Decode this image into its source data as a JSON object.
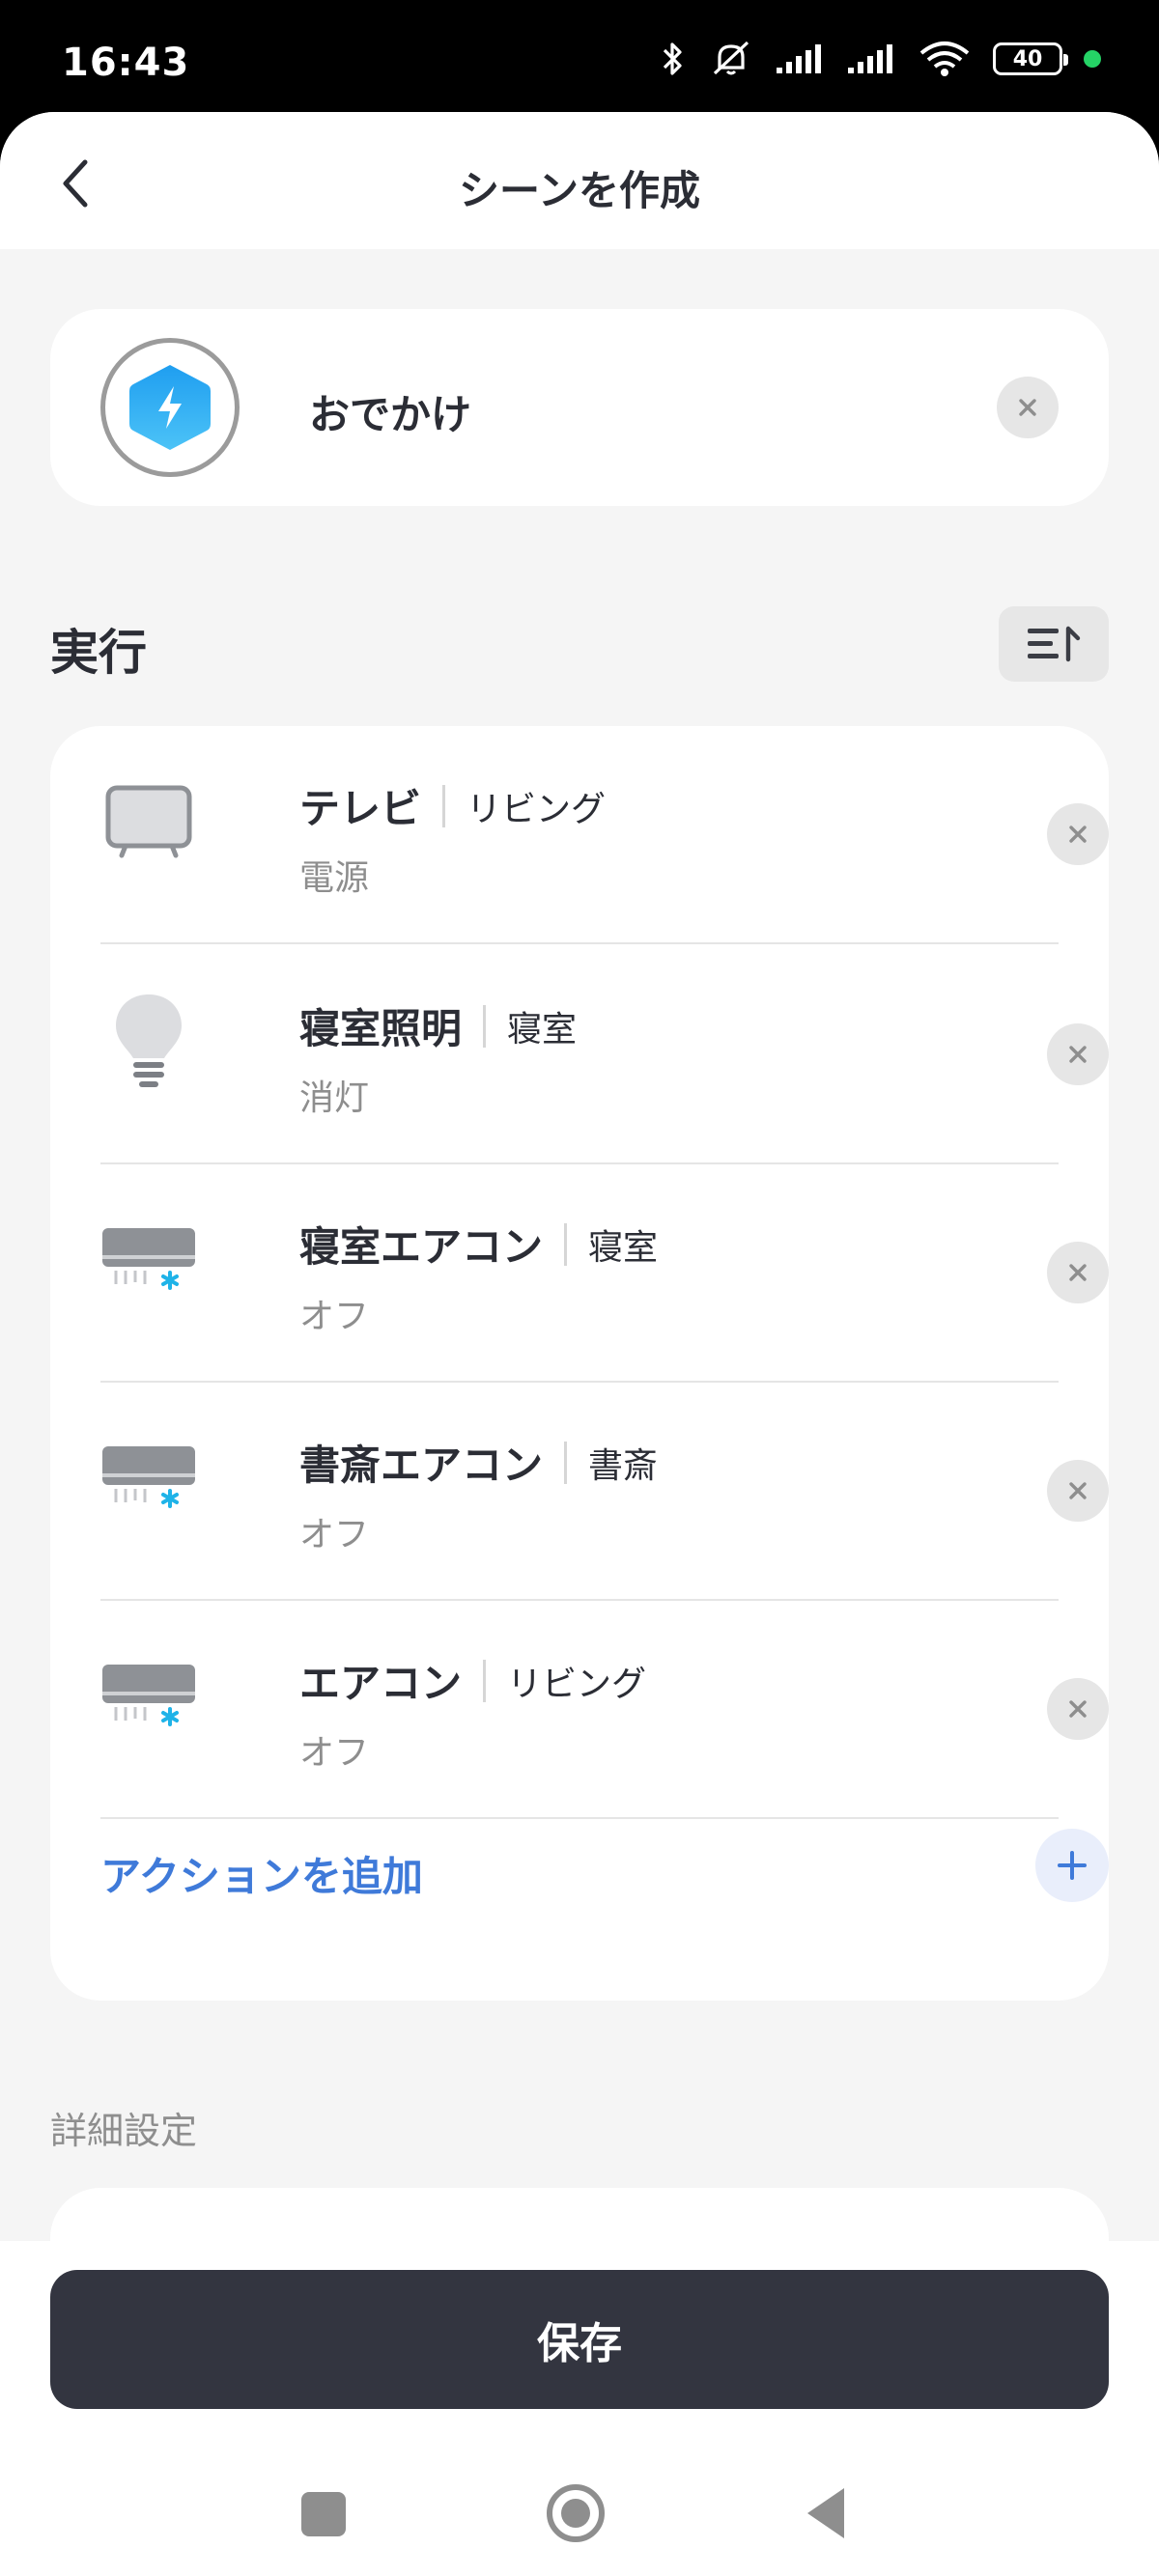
{
  "status_bar": {
    "time": "16:43",
    "battery": "40"
  },
  "header": {
    "title": "シーンを作成"
  },
  "scene": {
    "name": "おでかけ"
  },
  "section": {
    "title": "実行"
  },
  "actions": [
    {
      "name": "テレビ",
      "room": "リビング",
      "state": "電源",
      "icon": "tv-icon"
    },
    {
      "name": "寝室照明",
      "room": "寝室",
      "state": "消灯",
      "icon": "lightbulb-icon"
    },
    {
      "name": "寝室エアコン",
      "room": "寝室",
      "state": "オフ",
      "icon": "air-conditioner-icon"
    },
    {
      "name": "書斎エアコン",
      "room": "書斎",
      "state": "オフ",
      "icon": "air-conditioner-icon"
    },
    {
      "name": "エアコン",
      "room": "リビング",
      "state": "オフ",
      "icon": "air-conditioner-icon"
    }
  ],
  "add_action": {
    "label": "アクションを追加"
  },
  "details": {
    "title": "詳細設定"
  },
  "save": {
    "label": "保存"
  },
  "colors": {
    "accent": "#3f7ad9",
    "dark_button": "#333540",
    "scene_icon": "#29a8f2",
    "snow": "#1fb3e8"
  }
}
